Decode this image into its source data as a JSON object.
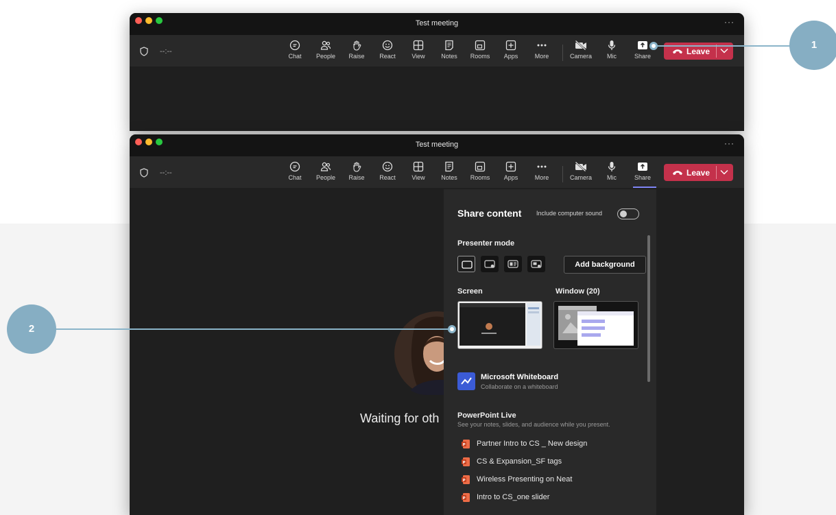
{
  "window": {
    "title": "Test meeting",
    "more_label": "···"
  },
  "toolbar": {
    "timer": "--:--",
    "buttons": [
      {
        "label": "Chat",
        "icon": "chat-icon"
      },
      {
        "label": "People",
        "icon": "people-icon"
      },
      {
        "label": "Raise",
        "icon": "raise-hand-icon"
      },
      {
        "label": "React",
        "icon": "react-smile-icon"
      },
      {
        "label": "View",
        "icon": "view-grid-icon"
      },
      {
        "label": "Notes",
        "icon": "notes-icon"
      },
      {
        "label": "Rooms",
        "icon": "rooms-icon"
      },
      {
        "label": "Apps",
        "icon": "apps-plus-icon"
      },
      {
        "label": "More",
        "icon": "more-dots-icon"
      },
      {
        "label": "Camera",
        "icon": "camera-off-icon"
      },
      {
        "label": "Mic",
        "icon": "mic-icon"
      },
      {
        "label": "Share",
        "icon": "share-tray-icon"
      }
    ],
    "leave_label": "Leave"
  },
  "stage": {
    "waiting_text": "Waiting for oth"
  },
  "share_panel": {
    "title": "Share content",
    "include_sound_label": "Include computer sound",
    "include_sound_on": false,
    "presenter_mode_label": "Presenter mode",
    "add_background_label": "Add background",
    "screen_label": "Screen",
    "window_label": "Window (20)",
    "whiteboard": {
      "title": "Microsoft Whiteboard",
      "subtitle": "Collaborate on a whiteboard"
    },
    "powerpoint": {
      "title": "PowerPoint Live",
      "subtitle": "See your notes, slides, and audience while you present.",
      "files": [
        "Partner Intro to CS _ New design",
        "CS & Expansion_SF tags",
        "Wireless Presenting on Neat",
        "Intro to CS_one slider"
      ]
    }
  },
  "callouts": [
    "1",
    "2"
  ],
  "colors": {
    "leave": "#c4314b",
    "accent": "#7f85f5",
    "callout": "#86aec3"
  }
}
